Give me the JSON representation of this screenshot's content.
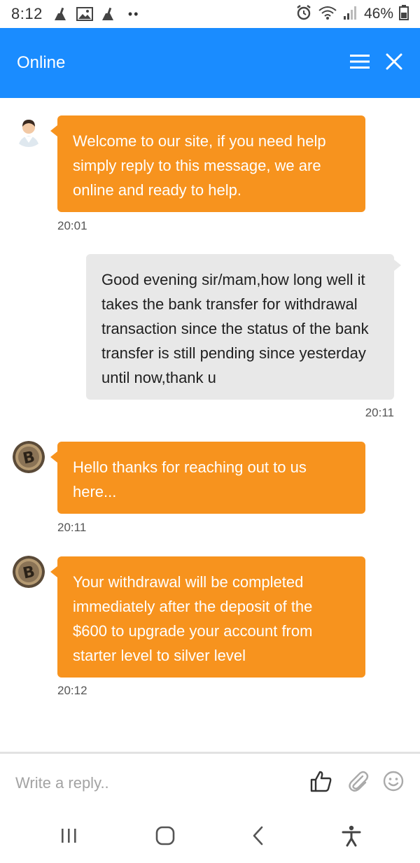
{
  "status_bar": {
    "time": "8:12",
    "dots": "••",
    "battery": "46%",
    "icons": [
      "cleaner-icon",
      "gallery-icon",
      "cleaner-icon",
      "alarm-icon",
      "wifi-icon",
      "signal-icon",
      "battery-icon"
    ]
  },
  "header": {
    "title": "Online",
    "background_color": "#1a8cff",
    "menu_icon": "hamburger-menu-icon",
    "close_icon": "close-icon"
  },
  "messages": [
    {
      "sender": "agent",
      "avatar": "agent-avatar",
      "text": "Welcome to our site, if you need help simply reply to this message, we are online and ready to help.",
      "lines": [
        "Welcome to our site, if you need help",
        "simply reply to this message, we are",
        "online and ready to help."
      ],
      "time": "20:01"
    },
    {
      "sender": "user",
      "text": "Good evening sir/mam,how long well it takes the bank transfer for withdrawal transaction since the status of the bank transfer is still pending since yesterday until now,thank u",
      "lines": [
        "Good evening sir/mam,how long well it",
        "takes the bank transfer for withdrawal",
        "transaction since the status of the bank",
        "transfer is still pending since yesterday",
        "until now,thank u"
      ],
      "time": "20:11"
    },
    {
      "sender": "agent",
      "avatar": "bitcoin-avatar",
      "text": "Hello thanks for reaching out to us here...",
      "lines": [
        "Hello thanks for reaching out to us",
        "here..."
      ],
      "time": "20:11"
    },
    {
      "sender": "agent",
      "avatar": "bitcoin-avatar",
      "text": "Your withdrawal will be completed immediately after the deposit of the $600 to upgrade your account from starter level to silver level",
      "lines": [
        "Your withdrawal will be completed",
        "immediately after the deposit of the",
        "$600 to upgrade your account from",
        "starter level to silver level"
      ],
      "time": "20:12"
    }
  ],
  "colors": {
    "agent_bubble": "#f7931e",
    "user_bubble": "#e8e8e8"
  },
  "composer": {
    "placeholder": "Write a reply..",
    "value": "",
    "icons": [
      "thumbs-up-icon",
      "paperclip-icon",
      "smiley-icon"
    ]
  },
  "navbar": {
    "icons": [
      "recent-apps-icon",
      "home-icon",
      "back-icon",
      "accessibility-icon"
    ]
  }
}
